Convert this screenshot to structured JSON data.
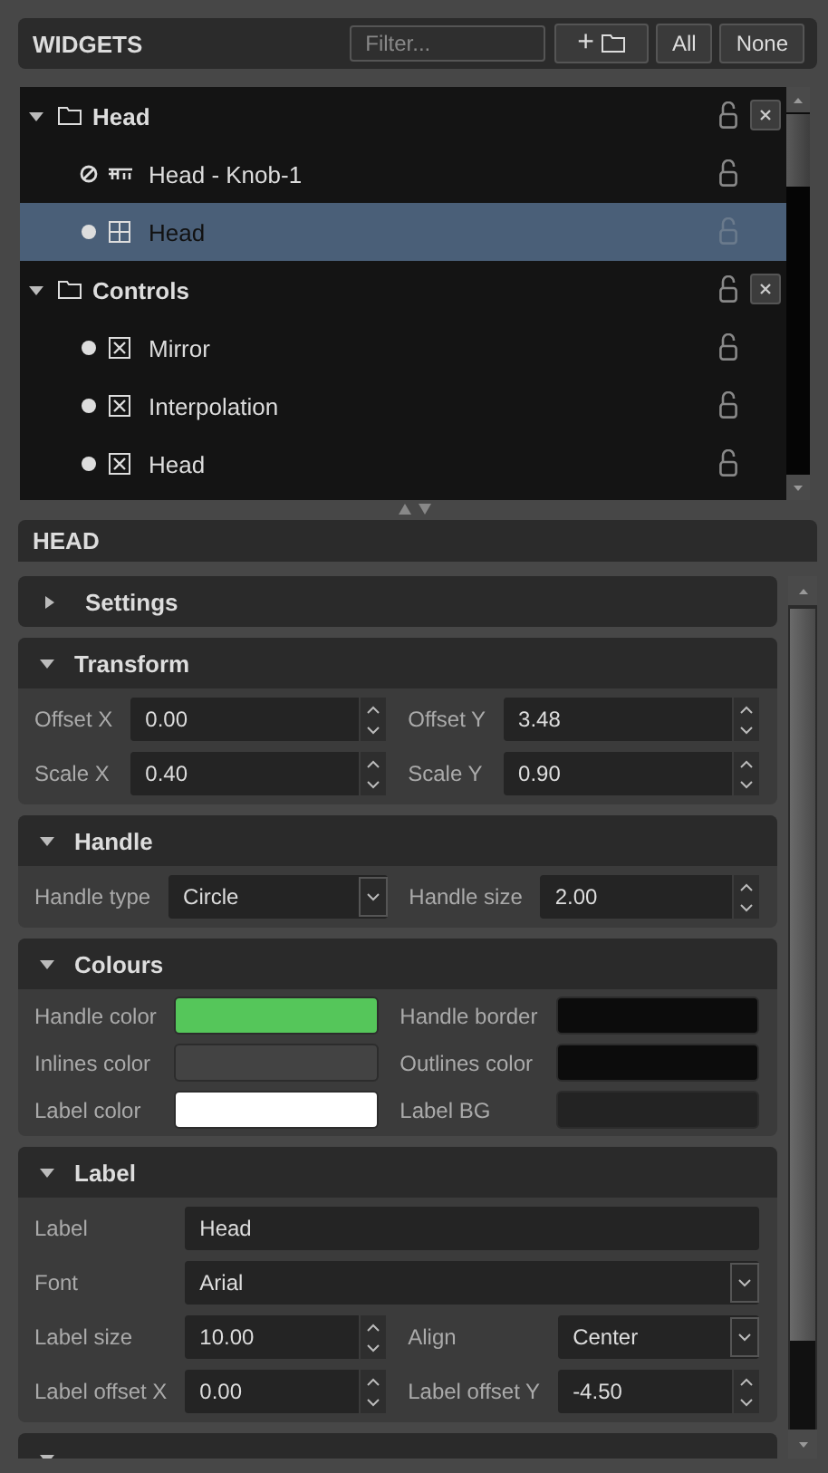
{
  "widgets_panel": {
    "title": "WIDGETS",
    "filter": {
      "placeholder": "Filter..."
    },
    "buttons": [
      {
        "kind": "add-folder",
        "label": "+"
      },
      {
        "kind": "text",
        "label": "All"
      },
      {
        "kind": "text",
        "label": "None"
      }
    ]
  },
  "tree": {
    "groups": [
      {
        "name": "Head",
        "expanded": true,
        "locked": false,
        "children": [
          {
            "name": "Head - Knob-1",
            "disabled": true,
            "kind": "knob",
            "locked": false,
            "selected": false
          },
          {
            "name": "Head",
            "disabled": false,
            "kind": "grid",
            "locked": false,
            "selected": true
          }
        ]
      },
      {
        "name": "Controls",
        "expanded": true,
        "locked": false,
        "children": [
          {
            "name": "Mirror",
            "disabled": false,
            "kind": "checkbox",
            "locked": false,
            "selected": false
          },
          {
            "name": "Interpolation",
            "disabled": false,
            "kind": "checkbox",
            "locked": false,
            "selected": false
          },
          {
            "name": "Head",
            "disabled": false,
            "kind": "checkbox",
            "locked": false,
            "selected": false
          }
        ]
      }
    ]
  },
  "inspector": {
    "title": "HEAD",
    "sections": [
      {
        "title": "Settings",
        "expanded": false
      },
      {
        "title": "Transform",
        "expanded": true,
        "rows": [
          [
            {
              "kind": "spin",
              "label": "Offset X",
              "value": "0.00"
            },
            {
              "kind": "spin",
              "label": "Offset Y",
              "value": "3.48"
            }
          ],
          [
            {
              "kind": "spin",
              "label": "Scale X",
              "value": "0.40"
            },
            {
              "kind": "spin",
              "label": "Scale Y",
              "value": "0.90"
            }
          ]
        ]
      },
      {
        "title": "Handle",
        "expanded": true,
        "rows": [
          [
            {
              "kind": "combo",
              "label": "Handle type",
              "value": "Circle"
            },
            {
              "kind": "spin",
              "label": "Handle size",
              "value": "2.00"
            }
          ]
        ]
      },
      {
        "title": "Colours",
        "expanded": true,
        "rows": [
          [
            {
              "kind": "color",
              "label": "Handle color",
              "color": "#55c65a"
            },
            {
              "kind": "color",
              "label": "Handle border",
              "color": "#0c0c0c"
            }
          ],
          [
            {
              "kind": "color",
              "label": "Inlines color",
              "color": "#434343"
            },
            {
              "kind": "color",
              "label": "Outlines color",
              "color": "#0c0c0c"
            }
          ],
          [
            {
              "kind": "color",
              "label": "Label color",
              "color": "#ffffff"
            },
            {
              "kind": "color",
              "label": "Label BG",
              "color": "#232323"
            }
          ]
        ]
      },
      {
        "title": "Label",
        "expanded": true,
        "rows": [
          [
            {
              "kind": "text",
              "label": "Label",
              "value": "Head"
            }
          ],
          [
            {
              "kind": "combo",
              "label": "Font",
              "value": "Arial"
            }
          ],
          [
            {
              "kind": "spin",
              "label": "Label size",
              "value": "10.00"
            },
            {
              "kind": "combo",
              "label": "Align",
              "value": "Center"
            }
          ],
          [
            {
              "kind": "spin",
              "label": "Label offset X",
              "value": "0.00"
            },
            {
              "kind": "spin",
              "label": "Label offset Y",
              "value": "-4.50"
            }
          ]
        ]
      },
      {
        "expanded": true
      }
    ]
  }
}
